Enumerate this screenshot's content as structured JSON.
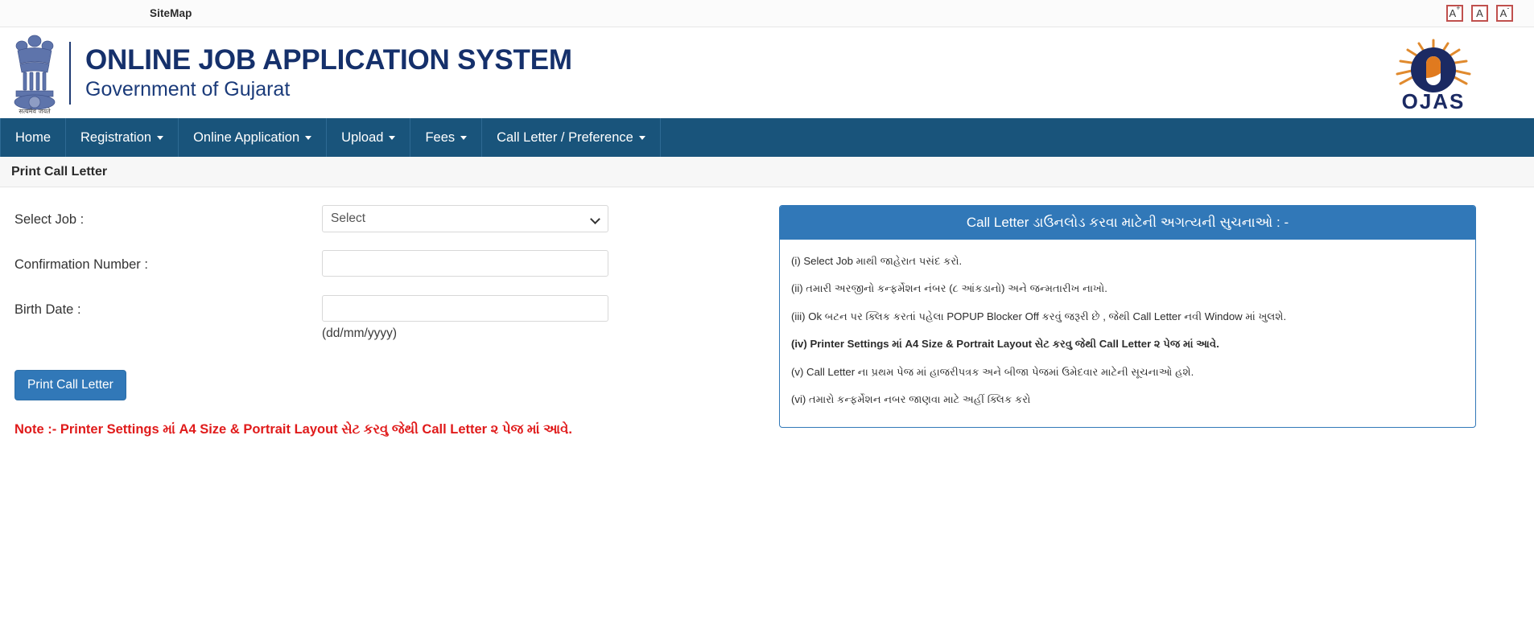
{
  "topbar": {
    "sitemap_label": "SiteMap",
    "font_buttons": [
      {
        "name": "font-increase",
        "label": "A",
        "sup": "+"
      },
      {
        "name": "font-normal",
        "label": "A",
        "sup": ""
      },
      {
        "name": "font-decrease",
        "label": "A",
        "sup": "-"
      }
    ]
  },
  "masthead": {
    "title": "ONLINE JOB APPLICATION SYSTEM",
    "subtitle": "Government of Gujarat",
    "emblem_motto": "सत्यमेव जयते",
    "logo_text": "OJAS"
  },
  "nav": {
    "items": [
      {
        "label": "Home",
        "caret": false,
        "name": "nav-item-home"
      },
      {
        "label": "Registration",
        "caret": true,
        "name": "nav-item-registration"
      },
      {
        "label": "Online Application",
        "caret": true,
        "name": "nav-item-online-application"
      },
      {
        "label": "Upload",
        "caret": true,
        "name": "nav-item-upload"
      },
      {
        "label": "Fees",
        "caret": true,
        "name": "nav-item-fees"
      },
      {
        "label": "Call Letter / Preference",
        "caret": true,
        "name": "nav-item-call-letter-preference"
      }
    ]
  },
  "page": {
    "title": "Print Call Letter"
  },
  "form": {
    "select_job_label": "Select Job :",
    "select_job_value": "Select",
    "confirmation_number_label": "Confirmation Number :",
    "confirmation_number_value": "",
    "birth_date_label": "Birth Date :",
    "birth_date_value": "",
    "birth_date_hint": "(dd/mm/yyyy)",
    "submit_label": "Print Call Letter",
    "note": "Note :- Printer Settings માં A4 Size & Portrait Layout સેટ કરવુ જેથી Call Letter ૨ પેજ માં આવે."
  },
  "instructions_panel": {
    "header": "Call Letter ડાઉનલોડ કરવા માટેની અગત્યની સુચનાઓ : -",
    "items": [
      {
        "text": "(i) Select Job માથી જાહેરાત પસંદ કરો.",
        "bold": false,
        "link": false
      },
      {
        "text": "(ii) તમારી અરજીનો કન્ફર્મેશન નંબર (૮ આંકડાનો) અને જન્મતારીખ નાખો.",
        "bold": false,
        "link": false
      },
      {
        "text": "(iii) Ok બટન પર ક્લિક કરતાં પહેલા POPUP Blocker Off કરવું જરૂરી છે , જેથી Call Letter નવી Window માં ખુલશે.",
        "bold": false,
        "link": false
      },
      {
        "text": "(iv) Printer Settings માં A4 Size & Portrait Layout સેટ કરવુ જેથી Call Letter ૨ પેજ માં આવે.",
        "bold": true,
        "link": false
      },
      {
        "text": "(v) Call Letter ના પ્રથમ પેજ માં હાજરીપત્રક અને બીજા પેજમાં ઉમેદવાર માટેની સૂચનાઓ હશે.",
        "bold": false,
        "link": false
      },
      {
        "text": "(vi) તમારો કન્ફર્મેશન નબર જાણવા માટે અહીં ક્લિક કરો",
        "bold": false,
        "link": true
      }
    ]
  },
  "colors": {
    "nav_bg": "#19547b",
    "panel_blue": "#3178b8",
    "title_navy": "#15306b",
    "note_red": "#e01b1b",
    "font_btn_border": "#c0504d"
  }
}
